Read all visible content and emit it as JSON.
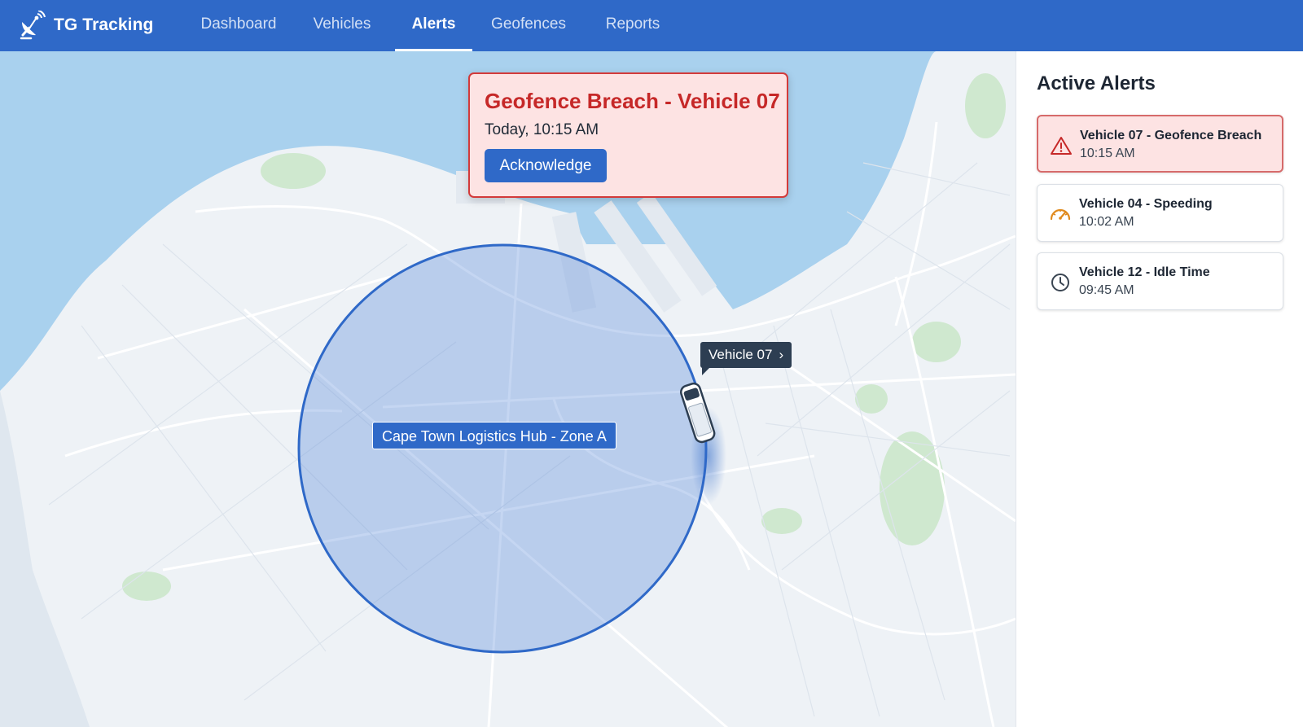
{
  "app": {
    "name": "TG Tracking",
    "logo_icon": "satellite-dish-icon"
  },
  "nav": {
    "items": [
      {
        "label": "Dashboard",
        "active": false
      },
      {
        "label": "Vehicles",
        "active": false
      },
      {
        "label": "Alerts",
        "active": true
      },
      {
        "label": "Geofences",
        "active": false
      },
      {
        "label": "Reports",
        "active": false
      }
    ]
  },
  "popup": {
    "title": "Geofence Breach - Vehicle 07",
    "time": "Today, 10:15 AM",
    "button_label": "Acknowledge"
  },
  "map": {
    "geofence_label": "Cape Town Logistics Hub - Zone A",
    "vehicle_label": "Vehicle 07",
    "vehicle_label_icon": "chevron-right-icon"
  },
  "sidebar": {
    "title": "Active Alerts",
    "alerts": [
      {
        "title": "Vehicle 07 - Geofence Breach",
        "time": "10:15 AM",
        "icon": "warning-triangle-icon",
        "severity": "critical"
      },
      {
        "title": "Vehicle 04 - Speeding",
        "time": "10:02 AM",
        "icon": "speedometer-icon",
        "severity": "warning"
      },
      {
        "title": "Vehicle 12 - Idle Time",
        "time": "09:45 AM",
        "icon": "clock-icon",
        "severity": "info"
      }
    ]
  },
  "colors": {
    "brand": "#2f69c8",
    "critical": "#c62828",
    "critical_bg": "#fde3e3",
    "warning": "#e08a1e",
    "water": "#a9d1ee",
    "land": "#eef2f6"
  }
}
